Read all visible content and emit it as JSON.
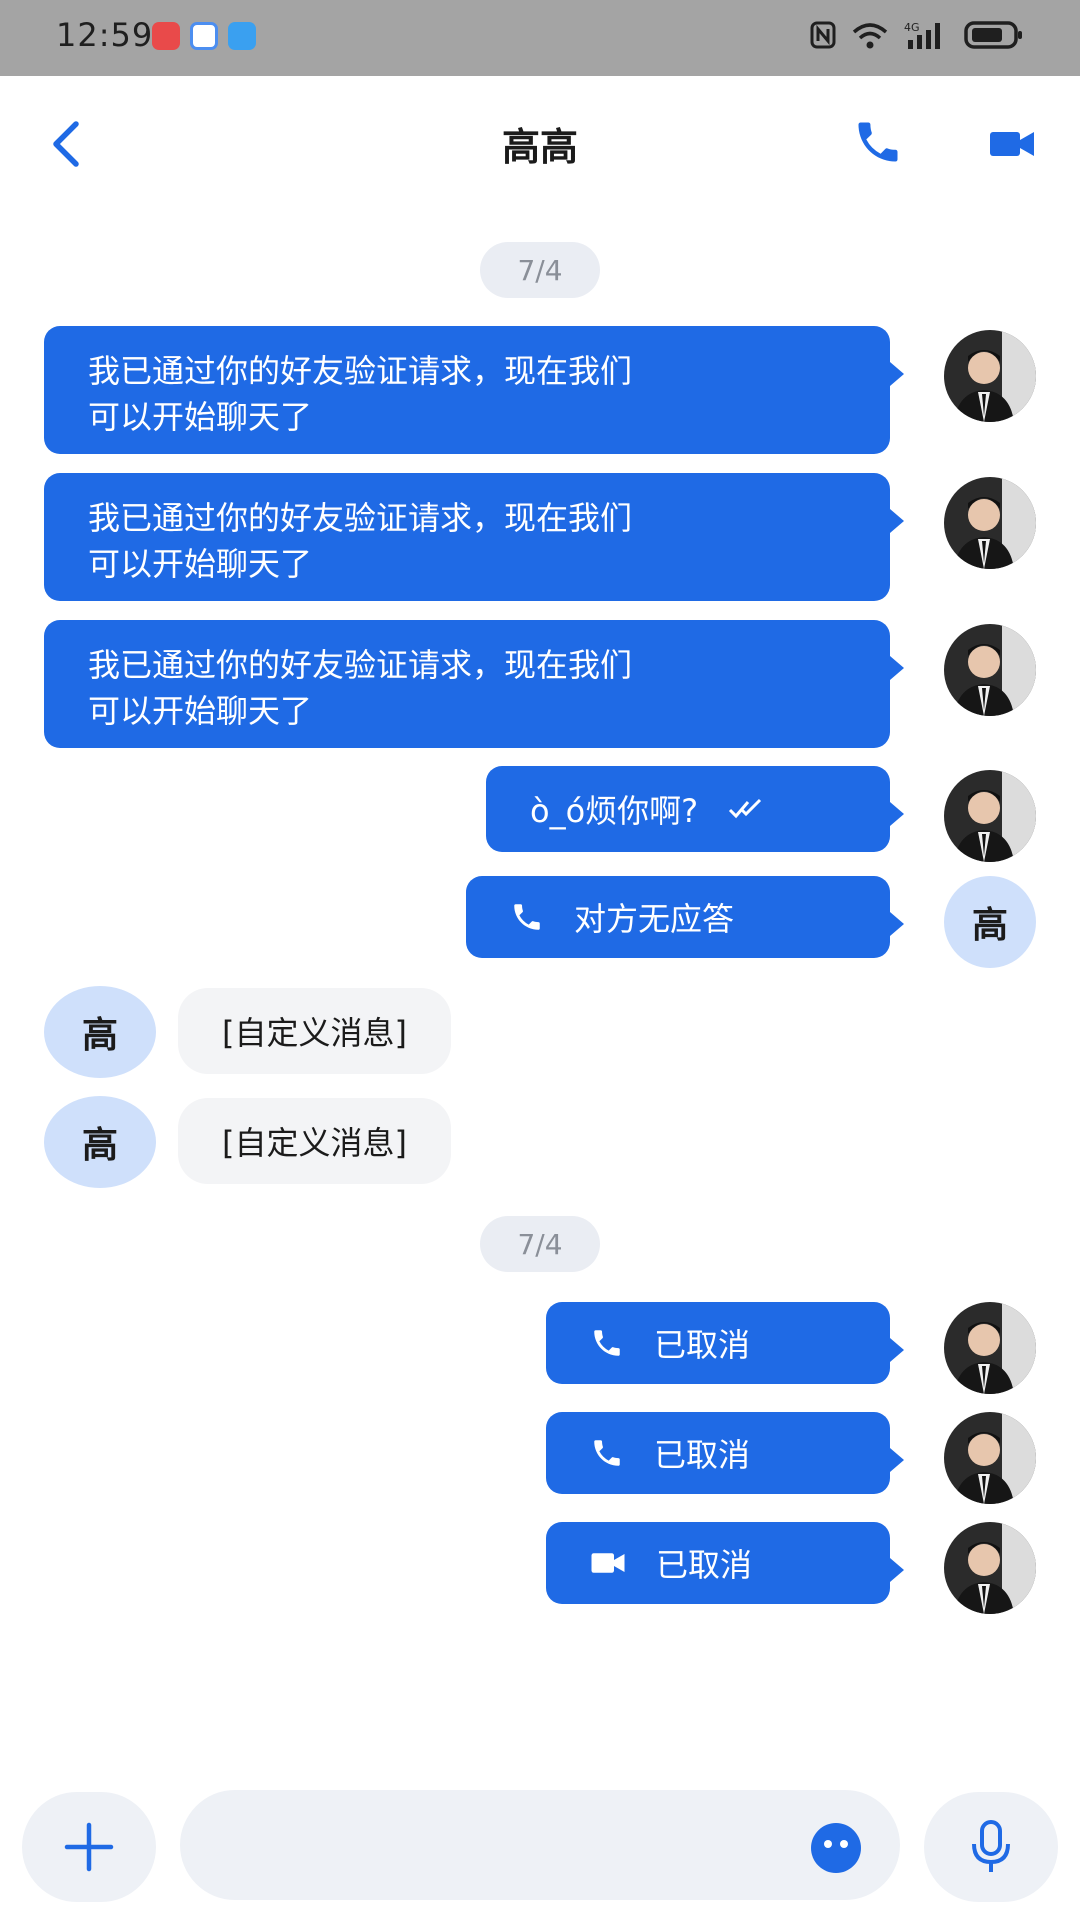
{
  "status_bar": {
    "time": "12:59",
    "right_icons": [
      "nfc-icon",
      "wifi-icon",
      "signal-4g-icon",
      "battery-icon"
    ]
  },
  "header": {
    "title": "高高",
    "back_icon": "chevron-left-icon",
    "call_icon": "phone-icon",
    "video_icon": "video-camera-icon"
  },
  "messages": {
    "date_1": "7/4",
    "date_2": "7/4",
    "m1_line1": "我已通过你的好友验证请求，现在我们",
    "m1_line2": "可以开始聊天了",
    "m2_line1": "我已通过你的好友验证请求，现在我们",
    "m2_line2": "可以开始聊天了",
    "m3_line1": "我已通过你的好友验证请求，现在我们",
    "m3_line2": "可以开始聊天了",
    "m4_text": "ò_ó烦你啊?",
    "m5_text": "对方无应答",
    "m6_text": "[自定义消息]",
    "m7_text": "[自定义消息]",
    "m8_text": "已取消",
    "m9_text": "已取消",
    "m10_text": "已取消"
  },
  "avatars": {
    "contact_initial": "高"
  },
  "colors": {
    "accent": "#1f6ae5",
    "status_bar": "#a4a4a4",
    "incoming_bubble": "#f3f4f6",
    "text_avatar_bg": "#cfe0fb"
  }
}
